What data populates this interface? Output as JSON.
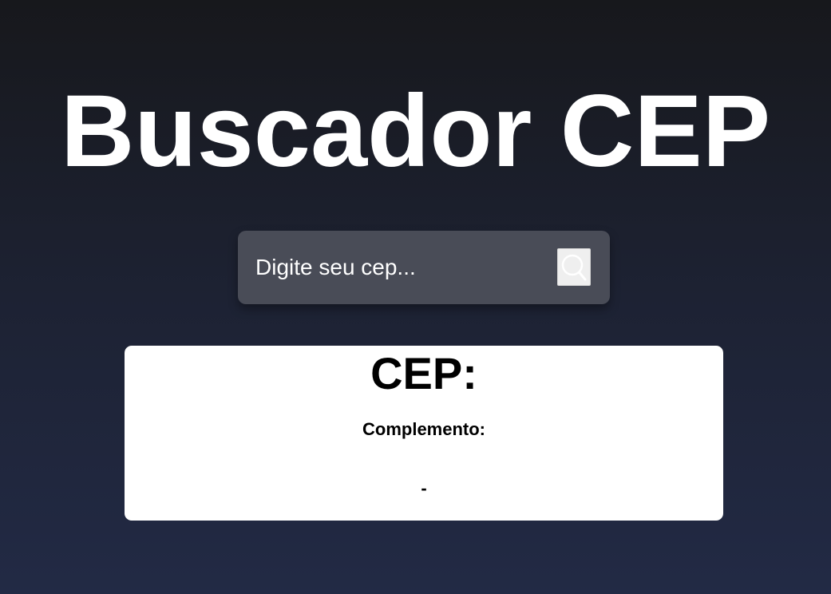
{
  "header": {
    "title": "Buscador CEP"
  },
  "search": {
    "placeholder": "Digite seu cep...",
    "value": "",
    "button_icon": "search-icon"
  },
  "result": {
    "cep_label": "CEP:",
    "complement_label": "Complemento:",
    "location_text": "-"
  },
  "colors": {
    "background_top": "#17181c",
    "background_bottom": "#222a45",
    "search_box": "#494c57",
    "card": "#ffffff",
    "title_text": "#ffffff"
  }
}
